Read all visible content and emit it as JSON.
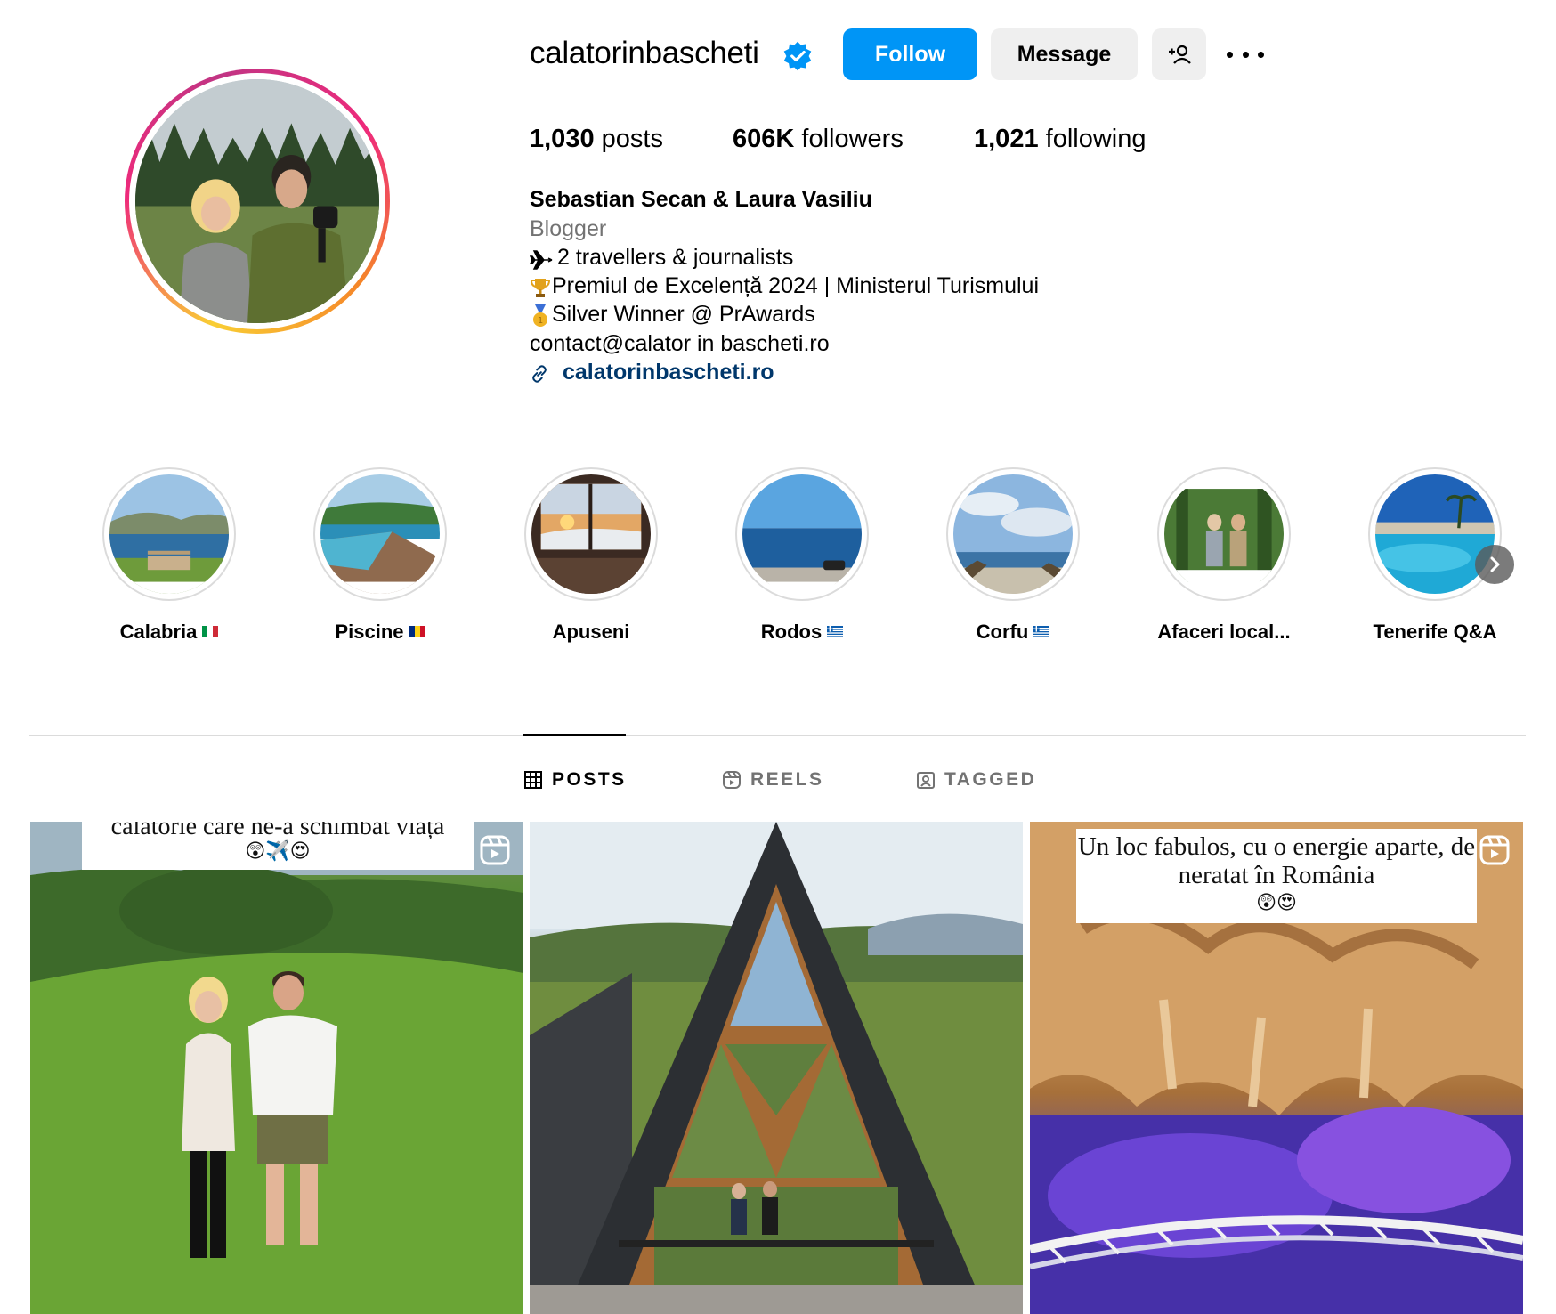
{
  "profile": {
    "username": "calatorinbascheti",
    "verified": true,
    "follow_label": "Follow",
    "message_label": "Message",
    "stats": {
      "posts_count": "1,030",
      "posts_label": "posts",
      "followers_count": "606K",
      "followers_label": "followers",
      "following_count": "1,021",
      "following_label": "following"
    },
    "bio": {
      "name": "Sebastian Secan & Laura Vasiliu",
      "category": "Blogger",
      "line1": "2 travellers & journalists",
      "line2": "Premiul de Excelență 2024 | Ministerul Turismului",
      "line3": "Silver Winner @ PrAwards",
      "line4": "contact@calator in bascheti.ro",
      "link": "calatorinbascheti.ro"
    }
  },
  "highlights": [
    {
      "label": "Calabria",
      "flag": "it"
    },
    {
      "label": "Piscine",
      "flag": "ro"
    },
    {
      "label": "Apuseni",
      "flag": ""
    },
    {
      "label": "Rodos",
      "flag": "gr"
    },
    {
      "label": "Corfu",
      "flag": "gr"
    },
    {
      "label": "Afaceri local...",
      "flag": ""
    },
    {
      "label": "Tenerife Q&A",
      "flag": ""
    }
  ],
  "tabs": {
    "posts": "POSTS",
    "reels": "REELS",
    "tagged": "TAGGED"
  },
  "posts": [
    {
      "caption": "călătorie care ne-a schimbat viața",
      "emojis": "😲✈️😍",
      "is_reel": true
    },
    {
      "caption": "",
      "emojis": "",
      "is_reel": false
    },
    {
      "caption": "Un loc fabulos, cu o energie aparte, de neratat în România",
      "emojis": "😲😍",
      "is_reel": true
    }
  ],
  "colors": {
    "accent": "#0095f6",
    "link": "#00376b",
    "muted": "#737373",
    "verified": "#0095f6"
  },
  "icons": [
    "verified-badge-icon",
    "add-user-icon",
    "more-options-icon",
    "airplane-icon",
    "trophy-icon",
    "medal-icon",
    "link-icon",
    "grid-icon",
    "reels-icon",
    "tagged-icon",
    "chevron-right-icon",
    "reel-badge-icon"
  ]
}
